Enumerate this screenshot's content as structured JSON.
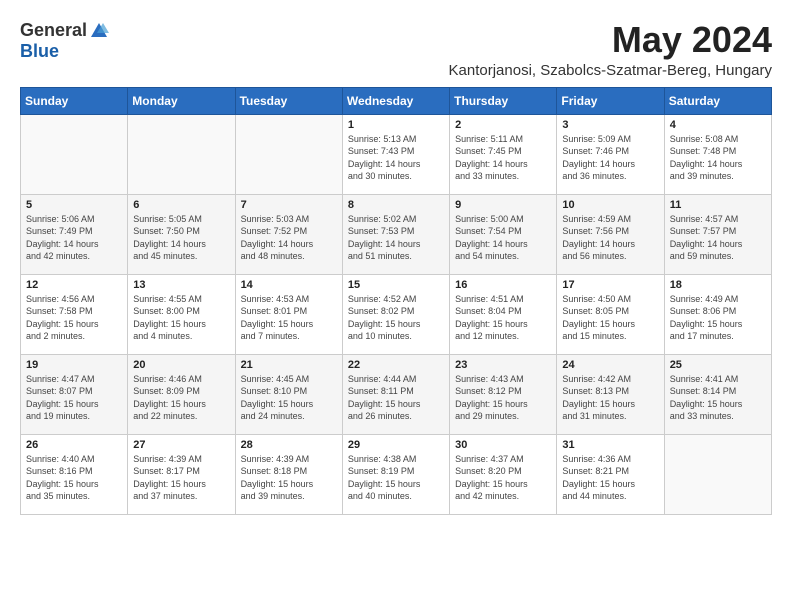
{
  "header": {
    "logo_general": "General",
    "logo_blue": "Blue",
    "title": "May 2024",
    "subtitle": "Kantorjanosi, Szabolcs-Szatmar-Bereg, Hungary"
  },
  "weekdays": [
    "Sunday",
    "Monday",
    "Tuesday",
    "Wednesday",
    "Thursday",
    "Friday",
    "Saturday"
  ],
  "weeks": [
    [
      {
        "day": "",
        "info": ""
      },
      {
        "day": "",
        "info": ""
      },
      {
        "day": "",
        "info": ""
      },
      {
        "day": "1",
        "info": "Sunrise: 5:13 AM\nSunset: 7:43 PM\nDaylight: 14 hours\nand 30 minutes."
      },
      {
        "day": "2",
        "info": "Sunrise: 5:11 AM\nSunset: 7:45 PM\nDaylight: 14 hours\nand 33 minutes."
      },
      {
        "day": "3",
        "info": "Sunrise: 5:09 AM\nSunset: 7:46 PM\nDaylight: 14 hours\nand 36 minutes."
      },
      {
        "day": "4",
        "info": "Sunrise: 5:08 AM\nSunset: 7:48 PM\nDaylight: 14 hours\nand 39 minutes."
      }
    ],
    [
      {
        "day": "5",
        "info": "Sunrise: 5:06 AM\nSunset: 7:49 PM\nDaylight: 14 hours\nand 42 minutes."
      },
      {
        "day": "6",
        "info": "Sunrise: 5:05 AM\nSunset: 7:50 PM\nDaylight: 14 hours\nand 45 minutes."
      },
      {
        "day": "7",
        "info": "Sunrise: 5:03 AM\nSunset: 7:52 PM\nDaylight: 14 hours\nand 48 minutes."
      },
      {
        "day": "8",
        "info": "Sunrise: 5:02 AM\nSunset: 7:53 PM\nDaylight: 14 hours\nand 51 minutes."
      },
      {
        "day": "9",
        "info": "Sunrise: 5:00 AM\nSunset: 7:54 PM\nDaylight: 14 hours\nand 54 minutes."
      },
      {
        "day": "10",
        "info": "Sunrise: 4:59 AM\nSunset: 7:56 PM\nDaylight: 14 hours\nand 56 minutes."
      },
      {
        "day": "11",
        "info": "Sunrise: 4:57 AM\nSunset: 7:57 PM\nDaylight: 14 hours\nand 59 minutes."
      }
    ],
    [
      {
        "day": "12",
        "info": "Sunrise: 4:56 AM\nSunset: 7:58 PM\nDaylight: 15 hours\nand 2 minutes."
      },
      {
        "day": "13",
        "info": "Sunrise: 4:55 AM\nSunset: 8:00 PM\nDaylight: 15 hours\nand 4 minutes."
      },
      {
        "day": "14",
        "info": "Sunrise: 4:53 AM\nSunset: 8:01 PM\nDaylight: 15 hours\nand 7 minutes."
      },
      {
        "day": "15",
        "info": "Sunrise: 4:52 AM\nSunset: 8:02 PM\nDaylight: 15 hours\nand 10 minutes."
      },
      {
        "day": "16",
        "info": "Sunrise: 4:51 AM\nSunset: 8:04 PM\nDaylight: 15 hours\nand 12 minutes."
      },
      {
        "day": "17",
        "info": "Sunrise: 4:50 AM\nSunset: 8:05 PM\nDaylight: 15 hours\nand 15 minutes."
      },
      {
        "day": "18",
        "info": "Sunrise: 4:49 AM\nSunset: 8:06 PM\nDaylight: 15 hours\nand 17 minutes."
      }
    ],
    [
      {
        "day": "19",
        "info": "Sunrise: 4:47 AM\nSunset: 8:07 PM\nDaylight: 15 hours\nand 19 minutes."
      },
      {
        "day": "20",
        "info": "Sunrise: 4:46 AM\nSunset: 8:09 PM\nDaylight: 15 hours\nand 22 minutes."
      },
      {
        "day": "21",
        "info": "Sunrise: 4:45 AM\nSunset: 8:10 PM\nDaylight: 15 hours\nand 24 minutes."
      },
      {
        "day": "22",
        "info": "Sunrise: 4:44 AM\nSunset: 8:11 PM\nDaylight: 15 hours\nand 26 minutes."
      },
      {
        "day": "23",
        "info": "Sunrise: 4:43 AM\nSunset: 8:12 PM\nDaylight: 15 hours\nand 29 minutes."
      },
      {
        "day": "24",
        "info": "Sunrise: 4:42 AM\nSunset: 8:13 PM\nDaylight: 15 hours\nand 31 minutes."
      },
      {
        "day": "25",
        "info": "Sunrise: 4:41 AM\nSunset: 8:14 PM\nDaylight: 15 hours\nand 33 minutes."
      }
    ],
    [
      {
        "day": "26",
        "info": "Sunrise: 4:40 AM\nSunset: 8:16 PM\nDaylight: 15 hours\nand 35 minutes."
      },
      {
        "day": "27",
        "info": "Sunrise: 4:39 AM\nSunset: 8:17 PM\nDaylight: 15 hours\nand 37 minutes."
      },
      {
        "day": "28",
        "info": "Sunrise: 4:39 AM\nSunset: 8:18 PM\nDaylight: 15 hours\nand 39 minutes."
      },
      {
        "day": "29",
        "info": "Sunrise: 4:38 AM\nSunset: 8:19 PM\nDaylight: 15 hours\nand 40 minutes."
      },
      {
        "day": "30",
        "info": "Sunrise: 4:37 AM\nSunset: 8:20 PM\nDaylight: 15 hours\nand 42 minutes."
      },
      {
        "day": "31",
        "info": "Sunrise: 4:36 AM\nSunset: 8:21 PM\nDaylight: 15 hours\nand 44 minutes."
      },
      {
        "day": "",
        "info": ""
      }
    ]
  ]
}
